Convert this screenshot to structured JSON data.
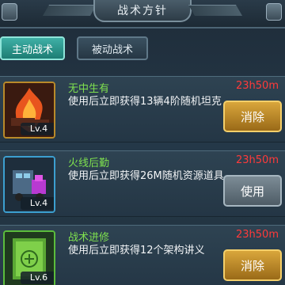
{
  "header": {
    "title": "战术方针"
  },
  "tabs": [
    {
      "label": "主动战术",
      "active": true
    },
    {
      "label": "被动战术",
      "active": false
    }
  ],
  "tactics": [
    {
      "name": "无中生有",
      "timer": "23h50m",
      "desc": "使用后立即获得13辆4阶随机坦克",
      "level": "Lv.4",
      "button": "消除",
      "icon": "tank-fire-icon",
      "frame_color": "#b98a2a",
      "button_style": "gold"
    },
    {
      "name": "火线后勤",
      "timer": "23h50m",
      "desc": "使用后立即获得26M随机资源道具",
      "level": "Lv.4",
      "button": "使用",
      "icon": "supply-truck-icon",
      "frame_color": "#3c9fd0",
      "button_style": "gray"
    },
    {
      "name": "战术进修",
      "timer": "23h50m",
      "desc": "使用后立即获得12个架构讲义",
      "level": "Lv.6",
      "button": "消除",
      "icon": "study-book-icon",
      "frame_color": "#5bbd3c",
      "button_style": "gold"
    }
  ],
  "colors": {
    "name": "#7ee04f",
    "timer": "#ff3a3a",
    "tab_active": "#3fb0a6",
    "button_gold": "#d9a63c"
  }
}
